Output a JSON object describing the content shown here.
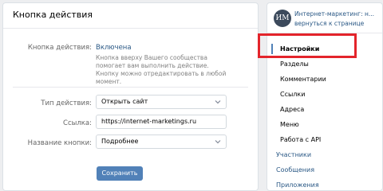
{
  "main": {
    "title": "Кнопка действия",
    "status_label": "Кнопка действия:",
    "status_value": "Включена",
    "description": "Кнопка вверху Вашего сообщества помогает вам выполнить действие. Кнопку можно отредактировать в любой момент.",
    "action_type_label": "Тип действия:",
    "action_type_value": "Открыть сайт",
    "link_label": "Ссылка:",
    "link_value": "https://internet-marketings.ru",
    "button_name_label": "Название кнопки:",
    "button_name_value": "Подробнее",
    "save_label": "Сохранить"
  },
  "sidebar": {
    "avatar_text": "ИМ",
    "group_name": "Интернет-маркетинг: н...",
    "back_link": "вернуться к странице",
    "items": [
      {
        "label": "Настройки"
      },
      {
        "label": "Разделы"
      },
      {
        "label": "Комментарии"
      },
      {
        "label": "Ссылки"
      },
      {
        "label": "Адреса"
      },
      {
        "label": "Меню"
      },
      {
        "label": "Работа с API"
      },
      {
        "label": "Участники"
      },
      {
        "label": "Сообщения"
      },
      {
        "label": "Приложения"
      }
    ]
  },
  "colors": {
    "accent": "#5181b8",
    "link": "#2a5885",
    "highlight": "#e3242b"
  }
}
